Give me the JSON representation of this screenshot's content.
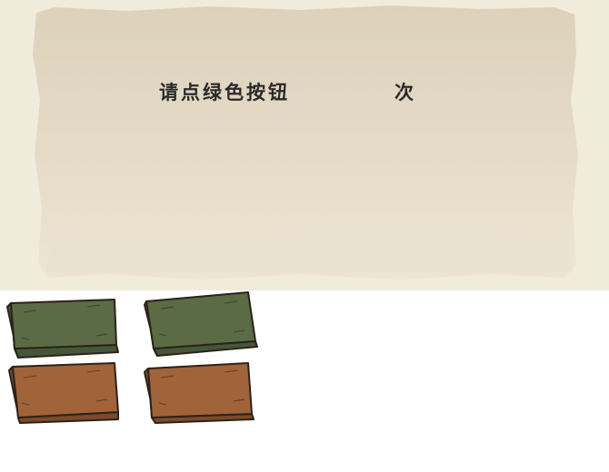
{
  "prompt": {
    "text_before": "请点绿色按钮",
    "count": "",
    "text_after": "次"
  },
  "buttons": [
    {
      "color_name": "green",
      "fill": "#5a6b46",
      "shade": "#46563a"
    },
    {
      "color_name": "green",
      "fill": "#5a6b46",
      "shade": "#46563a"
    },
    {
      "color_name": "brown",
      "fill": "#a1633a",
      "shade": "#7c4a2a"
    },
    {
      "color_name": "brown",
      "fill": "#a1633a",
      "shade": "#7c4a2a"
    }
  ],
  "colors": {
    "paper": "#e7dcc6",
    "paper_edge": "#f3ecdc",
    "outline": "#2b2218"
  }
}
